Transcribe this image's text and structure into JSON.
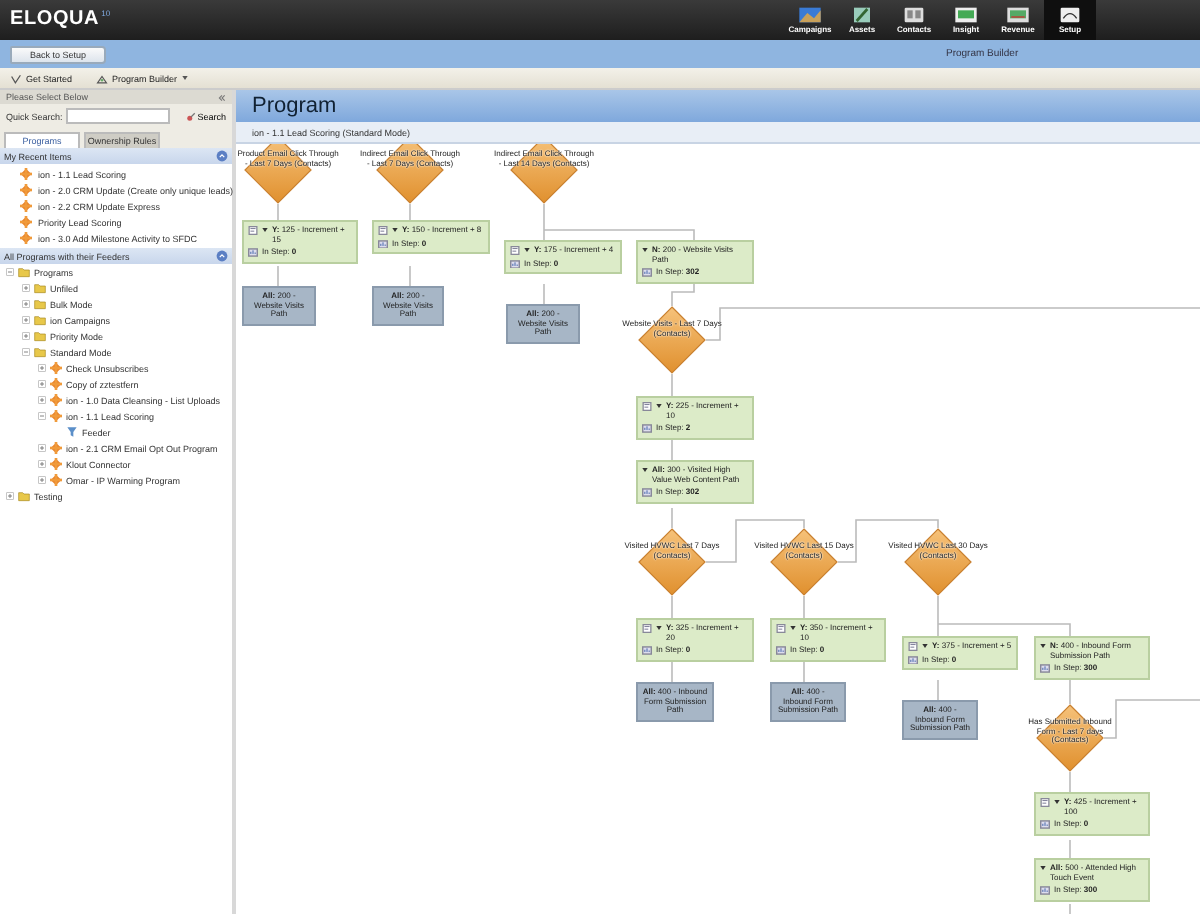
{
  "top_nav": {
    "logo": "ELOQUA",
    "logo_version": "10",
    "items": [
      {
        "label": "Campaigns",
        "selected": false
      },
      {
        "label": "Assets",
        "selected": false
      },
      {
        "label": "Contacts",
        "selected": false
      },
      {
        "label": "Insight",
        "selected": false
      },
      {
        "label": "Revenue",
        "selected": false
      },
      {
        "label": "Setup",
        "selected": true
      }
    ]
  },
  "sub_bar": {
    "back_button": "Back to Setup",
    "title": "Program Builder"
  },
  "toolbar": [
    {
      "label": "Get Started",
      "kind": "start"
    },
    {
      "label": "Program Builder",
      "kind": "menu"
    }
  ],
  "left_panel": {
    "header": "Please Select Below",
    "quick_search_label": "Quick Search:",
    "search_button": "Search",
    "tabs": [
      {
        "label": "Programs",
        "selected": true
      },
      {
        "label": "Ownership Rules",
        "selected": false
      }
    ],
    "recent": {
      "title": "My Recent Items",
      "items": [
        "ion - 1.1 Lead Scoring",
        "ion - 2.0 CRM Update (Create only unique leads)",
        "ion - 2.2 CRM Update Express",
        "Priority Lead Scoring",
        "ion - 3.0 Add Milestone Activity to SFDC"
      ]
    },
    "all_title": "All Programs with their Feeders",
    "tree": [
      {
        "label": "Programs",
        "kind": "folder",
        "expanded": true,
        "children": [
          {
            "label": "Unfiled",
            "kind": "folder",
            "expanded": false
          },
          {
            "label": "Bulk Mode",
            "kind": "folder",
            "expanded": false
          },
          {
            "label": "ion Campaigns",
            "kind": "folder",
            "expanded": false
          },
          {
            "label": "Priority Mode",
            "kind": "folder",
            "expanded": false
          },
          {
            "label": "Standard Mode",
            "kind": "folder",
            "expanded": true,
            "children": [
              {
                "label": "Check Unsubscribes",
                "kind": "program",
                "expanded": false
              },
              {
                "label": "Copy of zztestfern",
                "kind": "program",
                "expanded": false
              },
              {
                "label": "ion - 1.0 Data Cleansing - List Uploads",
                "kind": "program",
                "expanded": false
              },
              {
                "label": "ion - 1.1 Lead Scoring",
                "kind": "program",
                "expanded": true,
                "children": [
                  {
                    "label": "Feeder",
                    "kind": "feeder"
                  }
                ]
              },
              {
                "label": "ion - 2.1 CRM Email Opt Out Program",
                "kind": "program",
                "expanded": false
              },
              {
                "label": "Klout Connector",
                "kind": "program",
                "expanded": false
              },
              {
                "label": "Omar - IP Warming Program",
                "kind": "program",
                "expanded": false
              }
            ]
          }
        ]
      },
      {
        "label": "Testing",
        "kind": "folder",
        "expanded": false
      }
    ]
  },
  "canvas": {
    "header": "Program",
    "breadcrumb": "ion - 1.1 Lead Scoring (Standard Mode)",
    "nodes": [
      {
        "kind": "decision",
        "label": "Product Email Click Through - Last 7 Days (Contacts)"
      },
      {
        "kind": "decision",
        "label": "Indirect Email Click Through - Last 7 Days (Contacts)"
      },
      {
        "kind": "decision",
        "label": "Indirect Email Click Through - Last 14 Days (Contacts)"
      },
      {
        "kind": "step",
        "has_filter": true,
        "text": "**Y:** 125 - Increment + 15",
        "count": "In Step: **0**"
      },
      {
        "kind": "step",
        "has_filter": true,
        "text": "**Y:** 150 - Increment + 8",
        "count": "In Step: **0**"
      },
      {
        "kind": "step",
        "has_filter": true,
        "text": "**Y:** 175 - Increment + 4",
        "count": "In Step: **0**"
      },
      {
        "kind": "step",
        "has_filter": false,
        "text": "**N:** 200 - Website Visits Path",
        "count": "In Step: **302**"
      },
      {
        "kind": "action",
        "text": "**All:** 200 - Website Visits Path"
      },
      {
        "kind": "action",
        "text": "**All:** 200 - Website Visits Path"
      },
      {
        "kind": "action",
        "text": "**All:** 200 - Website Visits Path"
      },
      {
        "kind": "decision",
        "label": "Website Visits - Last 7 Days (Contacts)"
      },
      {
        "kind": "step",
        "has_filter": true,
        "text": "**Y:** 225 - Increment + 10",
        "count": "In Step: **2**"
      },
      {
        "kind": "step",
        "has_filter": false,
        "text": "**All:** 300 - Visited High Value Web Content Path",
        "count": "In Step: **302**"
      },
      {
        "kind": "decision",
        "label": "Visited HVWC Last 7 Days (Contacts)"
      },
      {
        "kind": "decision",
        "label": "Visited HVWC Last 15 Days (Contacts)"
      },
      {
        "kind": "decision",
        "label": "Visited HVWC Last 30 Days (Contacts)"
      },
      {
        "kind": "step",
        "has_filter": true,
        "text": "**Y:** 325 - Increment + 20",
        "count": "In Step: **0**"
      },
      {
        "kind": "step",
        "has_filter": true,
        "text": "**Y:** 350 - Increment + 10",
        "count": "In Step: **0**"
      },
      {
        "kind": "step",
        "has_filter": true,
        "text": "**Y:** 375 - Increment + 5",
        "count": "In Step: **0**"
      },
      {
        "kind": "step",
        "has_filter": false,
        "text": "**N:** 400 - Inbound Form Submission Path",
        "count": "In Step: **300**"
      },
      {
        "kind": "action",
        "text": "**All:** 400 - Inbound Form Submission Path"
      },
      {
        "kind": "action",
        "text": "**All:** 400 - Inbound Form Submission Path"
      },
      {
        "kind": "action",
        "text": "**All:** 400 - Inbound Form Submission Path"
      },
      {
        "kind": "decision",
        "label": "Has Submitted Inbound Form - Last 7 days (Contacts)"
      },
      {
        "kind": "step",
        "has_filter": true,
        "text": "**Y:** 425 - Increment + 100",
        "count": "In Step: **0**"
      },
      {
        "kind": "step",
        "has_filter": false,
        "text": "**All:** 500 - Attended High Touch Event",
        "count": "In Step: **300**"
      }
    ]
  }
}
